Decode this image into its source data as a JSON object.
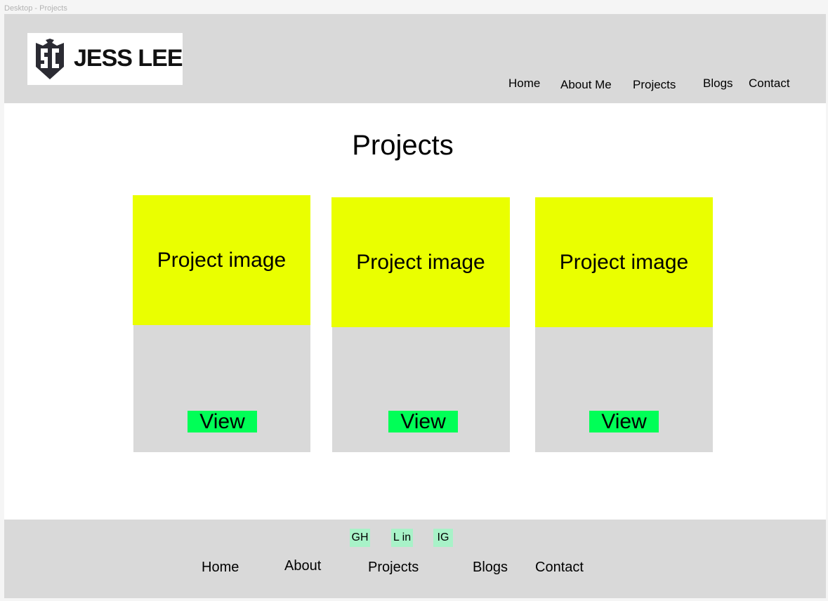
{
  "frame_label": "Desktop - Projects",
  "header": {
    "logo_text": "JESS LEE",
    "logo_icon": "shield-monogram-icon",
    "nav": [
      "Home",
      "About Me",
      "Projects",
      "Blogs",
      "Contact"
    ]
  },
  "main": {
    "title": "Projects",
    "cards": [
      {
        "image_label": "Project image",
        "button_label": "View"
      },
      {
        "image_label": "Project image",
        "button_label": "View"
      },
      {
        "image_label": "Project image",
        "button_label": "View"
      }
    ]
  },
  "footer": {
    "social": [
      "GH",
      "L in",
      "IG"
    ],
    "nav": [
      "Home",
      "About",
      "Projects",
      "Blogs",
      "Contact"
    ]
  },
  "colors": {
    "chrome_gray": "#d9d9d9",
    "image_placeholder": "#eaff00",
    "button_green": "#00ff57",
    "social_badge": "#a8f2c8"
  }
}
